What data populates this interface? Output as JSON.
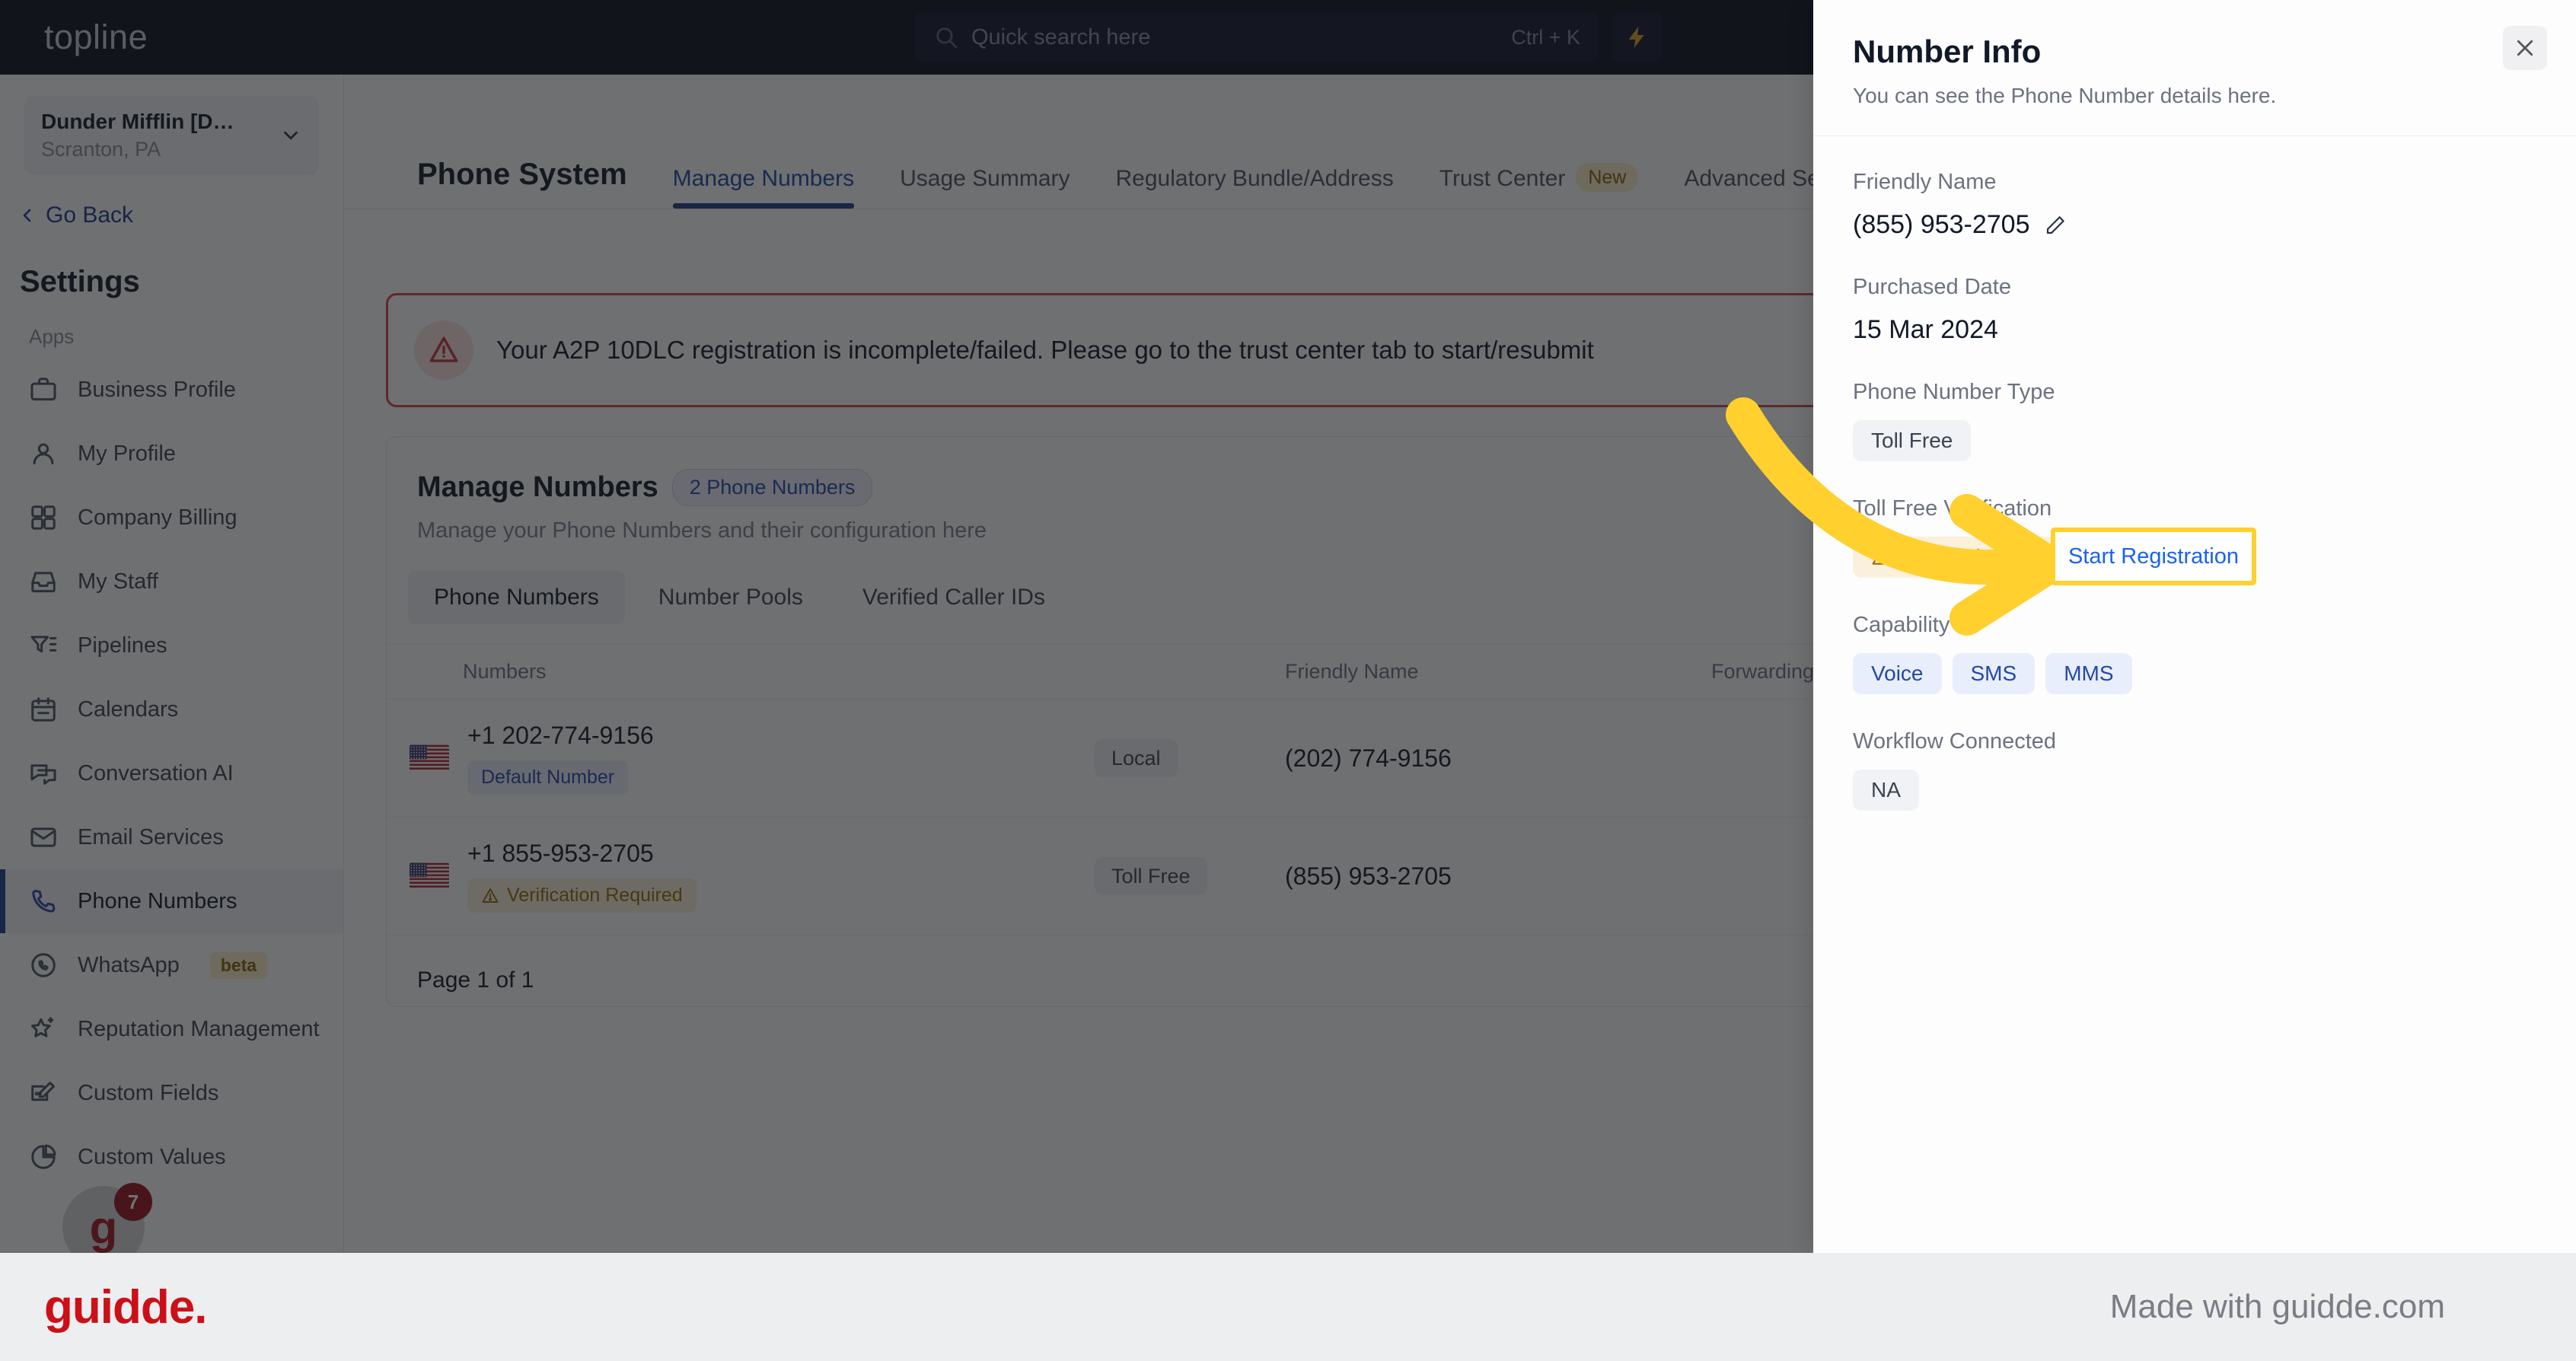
{
  "topbar": {
    "brand": "topline",
    "search_placeholder": "Quick search here",
    "search_value": "",
    "shortcut": "Ctrl + K",
    "bolt_icon": "lightning-bolt-icon",
    "search_icon": "search-icon"
  },
  "sidebar": {
    "org_name": "Dunder Mifflin [D…",
    "org_location": "Scranton, PA",
    "go_back": "Go Back",
    "section_title": "Settings",
    "group_label": "Apps",
    "items": [
      {
        "label": "Business Profile",
        "icon": "briefcase-icon",
        "active": false,
        "badge": ""
      },
      {
        "label": "My Profile",
        "icon": "user-icon",
        "active": false,
        "badge": ""
      },
      {
        "label": "Company Billing",
        "icon": "calculator-icon",
        "active": false,
        "badge": ""
      },
      {
        "label": "My Staff",
        "icon": "inbox-icon",
        "active": false,
        "badge": ""
      },
      {
        "label": "Pipelines",
        "icon": "funnel-icon",
        "active": false,
        "badge": ""
      },
      {
        "label": "Calendars",
        "icon": "calendar-icon",
        "active": false,
        "badge": ""
      },
      {
        "label": "Conversation AI",
        "icon": "chat-bubbles-icon",
        "active": false,
        "badge": ""
      },
      {
        "label": "Email Services",
        "icon": "envelope-icon",
        "active": false,
        "badge": ""
      },
      {
        "label": "Phone Numbers",
        "icon": "phone-icon",
        "active": true,
        "badge": ""
      },
      {
        "label": "WhatsApp",
        "icon": "whatsapp-icon",
        "active": false,
        "badge": "beta"
      },
      {
        "label": "Reputation Management",
        "icon": "star-sparkle-icon",
        "active": false,
        "badge": ""
      },
      {
        "label": "Custom Fields",
        "icon": "edit-box-icon",
        "active": false,
        "badge": ""
      },
      {
        "label": "Custom Values",
        "icon": "pie-chart-icon",
        "active": false,
        "badge": ""
      }
    ],
    "helper_bubble": {
      "letter": "g",
      "notification_count": "7"
    }
  },
  "main": {
    "page_title": "Phone System",
    "tabs": [
      {
        "label": "Manage Numbers",
        "active": true,
        "badge": ""
      },
      {
        "label": "Usage Summary",
        "active": false,
        "badge": ""
      },
      {
        "label": "Regulatory Bundle/Address",
        "active": false,
        "badge": ""
      },
      {
        "label": "Trust Center",
        "active": false,
        "badge": "New"
      },
      {
        "label": "Advanced Sett",
        "active": false,
        "badge": ""
      }
    ],
    "alert": {
      "icon": "warning-triangle-icon",
      "text": "Your A2P 10DLC registration is incomplete/failed. Please go to the trust center tab to start/resubmit"
    },
    "card": {
      "title": "Manage Numbers",
      "count_badge": "2 Phone Numbers",
      "subtitle": "Manage your Phone Numbers and their configuration here",
      "subtabs": [
        {
          "label": "Phone Numbers",
          "active": true
        },
        {
          "label": "Number Pools",
          "active": false
        },
        {
          "label": "Verified Caller IDs",
          "active": false
        }
      ],
      "columns": [
        "Numbers",
        "",
        "Friendly Name",
        "Forwarding Number"
      ],
      "rows": [
        {
          "flag": "us-flag-icon",
          "number": "+1 202-774-9156",
          "badge": "Default Number",
          "badge_style": "blue",
          "badge_icon": "",
          "type": "Local",
          "friendly_name": "(202) 774-9156",
          "forwarding_number": ""
        },
        {
          "flag": "us-flag-icon",
          "number": "+1 855-953-2705",
          "badge": "Verification Required",
          "badge_style": "amber",
          "badge_icon": "warning-triangle-icon",
          "type": "Toll Free",
          "friendly_name": "(855) 953-2705",
          "forwarding_number": ""
        }
      ],
      "pagination": "Page 1 of 1"
    }
  },
  "panel": {
    "title": "Number Info",
    "subtitle": "You can see the Phone Number details here.",
    "close_icon": "close-icon",
    "fields": {
      "friendly_name_label": "Friendly Name",
      "friendly_name_value": "(855) 953-2705",
      "friendly_name_edit_icon": "pencil-icon",
      "purchased_date_label": "Purchased Date",
      "purchased_date_value": "15 Mar 2024",
      "phone_number_type_label": "Phone Number Type",
      "phone_number_type_value": "Toll Free",
      "toll_free_verification_label": "Toll Free Verification",
      "toll_free_verification_status": "Verification Required",
      "toll_free_verification_icon": "warning-triangle-icon",
      "start_registration_label": "Start Registration",
      "capability_label": "Capability",
      "capabilities": [
        "Voice",
        "SMS",
        "MMS"
      ],
      "workflow_connected_label": "Workflow Connected",
      "workflow_connected_value": "NA"
    }
  },
  "footer": {
    "logo": "guidde.",
    "made_with": "Made with guidde.com"
  },
  "colors": {
    "brand_dark": "#080e1c",
    "accent_blue": "#1b3a8a",
    "link_blue": "#1b62f0",
    "alert_red": "#d64545",
    "highlight_yellow": "#ffd02e",
    "guidde_red": "#cc1018"
  }
}
